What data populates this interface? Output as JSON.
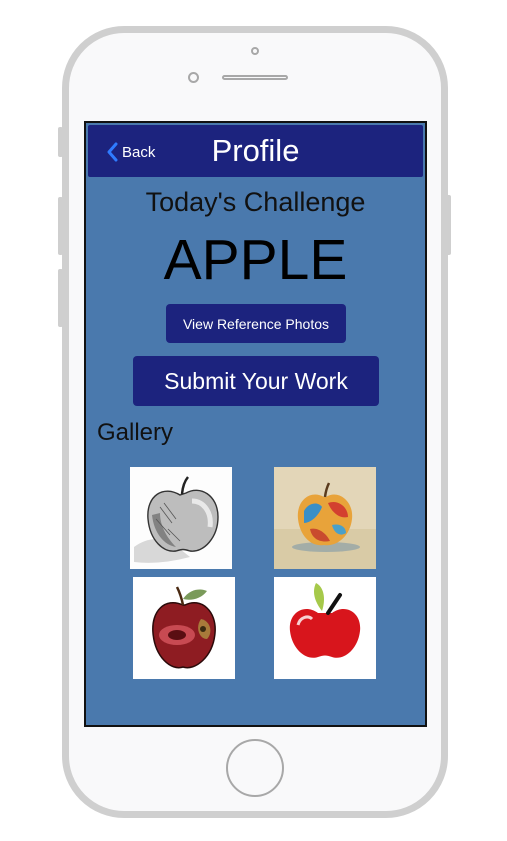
{
  "header": {
    "back_label": "Back",
    "title": "Profile"
  },
  "challenge": {
    "heading": "Today's Challenge",
    "word": "APPLE"
  },
  "actions": {
    "reference_label": "View Reference Photos",
    "submit_label": "Submit Your Work"
  },
  "gallery": {
    "label": "Gallery",
    "items": [
      {
        "icon": "pencil-sketch-apple"
      },
      {
        "icon": "painted-colorful-apple"
      },
      {
        "icon": "rotten-apple-illustration"
      },
      {
        "icon": "cartoon-red-apple"
      }
    ]
  },
  "colors": {
    "navbar": "#1c237e",
    "screen_bg": "#4a79ad",
    "button": "#1c237e",
    "phone_frame": "#cfcfcf"
  }
}
